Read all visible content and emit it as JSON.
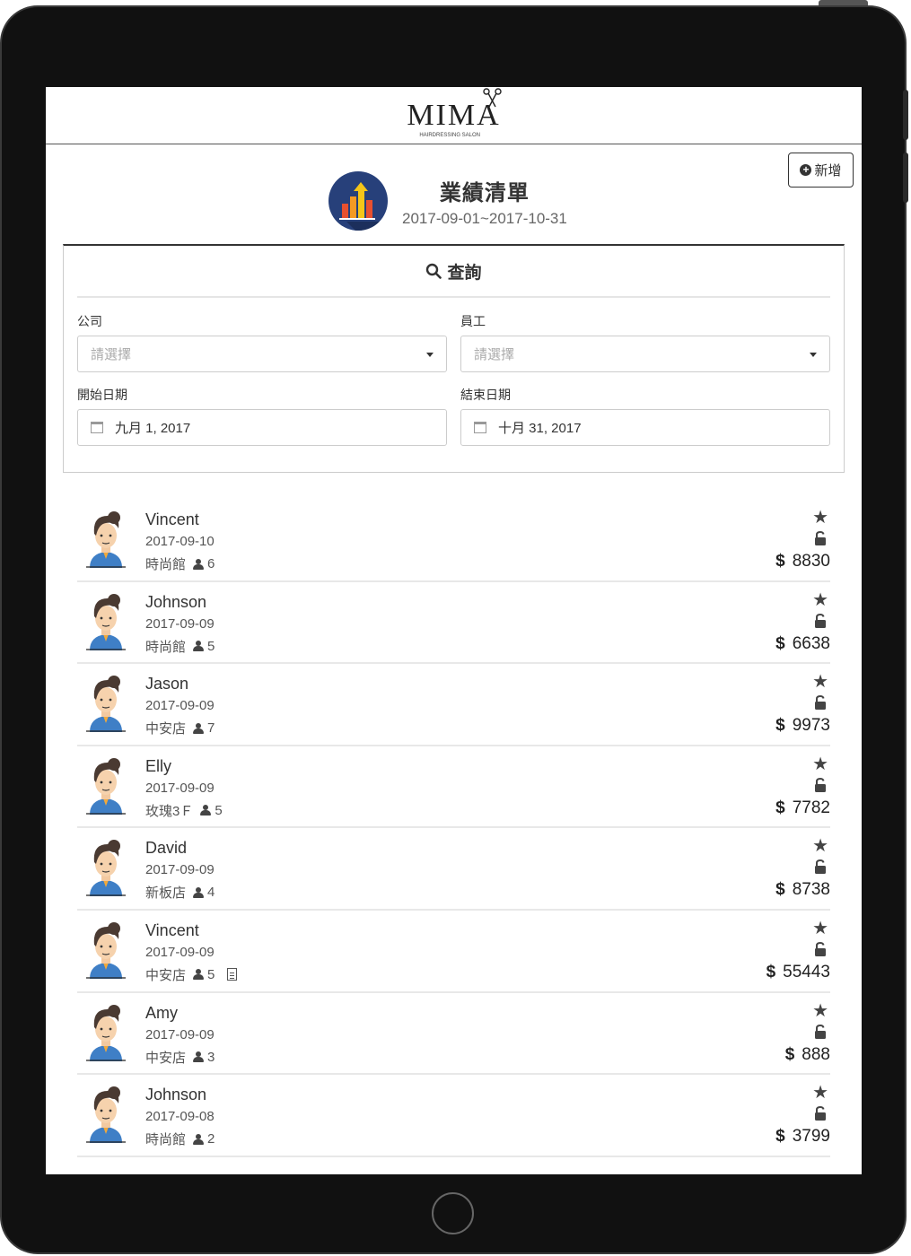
{
  "app": {
    "logo": "MIMA",
    "logo_sub": "HAIRDRESSING SALON"
  },
  "toolbar": {
    "add_label": "新增"
  },
  "page": {
    "title": "業績清單",
    "date_range": "2017-09-01~2017-10-31"
  },
  "query": {
    "heading": "查詢",
    "company_label": "公司",
    "company_placeholder": "請選擇",
    "staff_label": "員工",
    "staff_placeholder": "請選擇",
    "start_label": "開始日期",
    "start_value": "九月 1, 2017",
    "end_label": "結束日期",
    "end_value": "十月 31, 2017"
  },
  "currency": "$",
  "records": [
    {
      "name": "Vincent",
      "date": "2017-09-10",
      "store": "時尚館",
      "count": "6",
      "amount": "8830",
      "has_doc": false
    },
    {
      "name": "Johnson",
      "date": "2017-09-09",
      "store": "時尚館",
      "count": "5",
      "amount": "6638",
      "has_doc": false
    },
    {
      "name": "Jason",
      "date": "2017-09-09",
      "store": "中安店",
      "count": "7",
      "amount": "9973",
      "has_doc": false
    },
    {
      "name": "Elly",
      "date": "2017-09-09",
      "store": "玫瑰3Ｆ",
      "count": "5",
      "amount": "7782",
      "has_doc": false
    },
    {
      "name": "David",
      "date": "2017-09-09",
      "store": "新板店",
      "count": "4",
      "amount": "8738",
      "has_doc": false
    },
    {
      "name": "Vincent",
      "date": "2017-09-09",
      "store": "中安店",
      "count": "5",
      "amount": "55443",
      "has_doc": true
    },
    {
      "name": "Amy",
      "date": "2017-09-09",
      "store": "中安店",
      "count": "3",
      "amount": "888",
      "has_doc": false
    },
    {
      "name": "Johnson",
      "date": "2017-09-08",
      "store": "時尚館",
      "count": "2",
      "amount": "3799",
      "has_doc": false
    }
  ]
}
